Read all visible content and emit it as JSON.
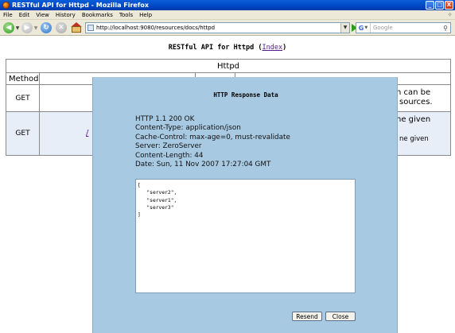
{
  "window": {
    "title": "RESTful API for Httpd - Mozilla Firefox",
    "controls": {
      "minimize": "_",
      "maximize": "□",
      "close": "X"
    }
  },
  "menu": {
    "items": [
      {
        "label": "File"
      },
      {
        "label": "Edit"
      },
      {
        "label": "View"
      },
      {
        "label": "History"
      },
      {
        "label": "Bookmarks"
      },
      {
        "label": "Tools"
      },
      {
        "label": "Help"
      }
    ]
  },
  "toolbar": {
    "url": "http://localhost:9080/resources/docs/httpd",
    "search_placeholder": "Google",
    "search_engine_letter": "G"
  },
  "page": {
    "heading": "RESTful API for Httpd",
    "index_open": "(",
    "index_link": "Index",
    "index_close": ")",
    "table": {
      "caption": "Httpd",
      "column_method": "Method",
      "rows": [
        {
          "method": "GET",
          "visible_right": "n can be",
          "visible_right2": "sources."
        },
        {
          "method": "GET",
          "visible_left": "/",
          "visible_right": "he given",
          "visible_right2": "ne given"
        }
      ]
    }
  },
  "modal": {
    "title": "HTTP Response Data",
    "headers": [
      "HTTP 1.1 200 OK",
      "Content-Type: application/json",
      "Cache-Control: max-age=0, must-revalidate",
      "Server: ZeroServer",
      "Content-Length: 44",
      "Date: Sun, 11 Nov 2007 17:27:04 GMT"
    ],
    "body": "[\n   \"server2\",\n   \"server1\",\n   \"server3\"\n]",
    "resend_label": "Resend",
    "close_label": "Close"
  }
}
